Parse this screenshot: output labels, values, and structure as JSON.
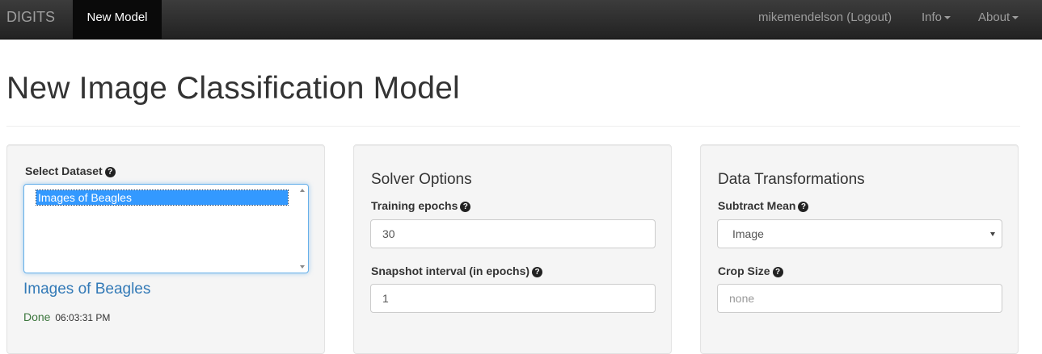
{
  "navbar": {
    "brand": "DIGITS",
    "active_item": "New Model",
    "user": "mikemendelson (Logout)",
    "info": "Info",
    "about": "About"
  },
  "page": {
    "title": "New Image Classification Model"
  },
  "dataset_panel": {
    "label": "Select Dataset",
    "options": [
      "Images of Beagles"
    ],
    "selected_link": "Images of Beagles",
    "status": "Done",
    "timestamp": "06:03:31 PM"
  },
  "solver_panel": {
    "heading": "Solver Options",
    "training_epochs_label": "Training epochs",
    "training_epochs_value": "30",
    "snapshot_label": "Snapshot interval (in epochs)",
    "snapshot_value": "1"
  },
  "transform_panel": {
    "heading": "Data Transformations",
    "subtract_mean_label": "Subtract Mean",
    "subtract_mean_value": "Image",
    "crop_size_label": "Crop Size",
    "crop_size_placeholder": "none"
  },
  "icons": {
    "help": "?"
  },
  "colors": {
    "navbar_bg": "#222222",
    "link": "#337ab7",
    "selection": "#3399ff",
    "status_success": "#3c763d"
  }
}
